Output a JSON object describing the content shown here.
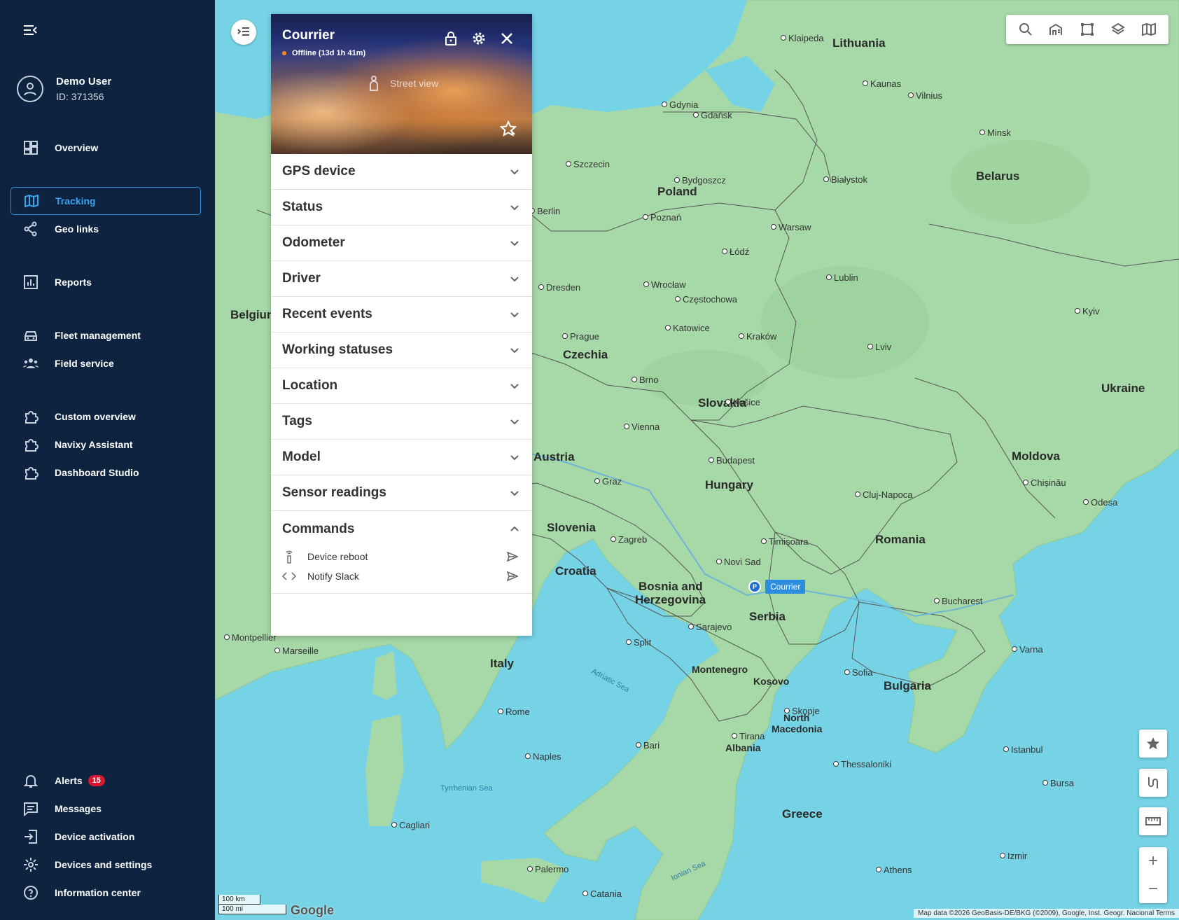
{
  "user": {
    "name": "Demo User",
    "id": "ID: 371356"
  },
  "nav": {
    "overview": "Overview",
    "tracking": "Tracking",
    "geo_links": "Geo links",
    "reports": "Reports",
    "fleet_management": "Fleet management",
    "field_service": "Field service",
    "custom_overview": "Custom overview",
    "navixy_assistant": "Navixy Assistant",
    "dashboard_studio": "Dashboard Studio",
    "alerts": "Alerts",
    "alerts_count": "15",
    "messages": "Messages",
    "device_activation": "Device activation",
    "devices_settings": "Devices and settings",
    "information_center": "Information center"
  },
  "panel": {
    "title": "Courrier",
    "status": "Offline (13d 1h 41m)",
    "street_view": "Street view",
    "sections": [
      "GPS device",
      "Status",
      "Odometer",
      "Driver",
      "Recent events",
      "Working statuses",
      "Location",
      "Tags",
      "Model",
      "Sensor readings"
    ],
    "commands_title": "Commands",
    "commands": [
      {
        "label": "Device reboot",
        "icon": "antenna-icon"
      },
      {
        "label": "Notify Slack",
        "icon": "code-icon"
      }
    ]
  },
  "map": {
    "marker_label": "Courrier",
    "marker_badge": "P",
    "scale_km": "100 km",
    "scale_mi": "100 mi",
    "logo": "Google",
    "attribution": "Map data ©2026 GeoBasis-DE/BKG (©2009), Google, Inst. Geogr. Nacional    Terms",
    "countries": [
      "Lithuania",
      "Poland",
      "Belarus",
      "Czechia",
      "Slovakia",
      "Ukraine",
      "Austria",
      "Hungary",
      "Moldova",
      "Slovenia",
      "Croatia",
      "Romania",
      "Bosnia and",
      "Herzegovina",
      "Serbia",
      "Italy",
      "Montenegro",
      "Kosovo",
      "Bulgaria",
      "North",
      "Macedonia",
      "Albania",
      "Greece",
      "Belgium"
    ],
    "cities": [
      "Klaipeda",
      "Kaunas",
      "Vilnius",
      "Gdańsk",
      "Gdynia",
      "Minsk",
      "Szczecin",
      "Bydgoszcz",
      "Berlin",
      "Poznań",
      "Warsaw",
      "Białystok",
      "Łódź",
      "Lublin",
      "Dresden",
      "Wrocław",
      "Częstochowa",
      "Prague",
      "Katowice",
      "Kraków",
      "Lviv",
      "Brno",
      "Vienna",
      "Košice",
      "Budapest",
      "Graz",
      "Zagreb",
      "Timișoara",
      "Cluj-Napoca",
      "Novi Sad",
      "Sarajevo",
      "Bucharest",
      "Sofia",
      "Rome",
      "Naples",
      "Bari",
      "Tirana",
      "Thessaloniki",
      "Istanbul",
      "Bursa",
      "Izmir",
      "Athens",
      "Palermo",
      "Catania",
      "Chișinău",
      "Kyiv",
      "Odesa",
      "Marseille",
      "Montpellier",
      "Varna",
      "Cagliari",
      "Split",
      "Skopje"
    ],
    "seas": [
      "Adriatic Sea",
      "Tyrrhenian Sea",
      "Ionian Sea"
    ]
  }
}
